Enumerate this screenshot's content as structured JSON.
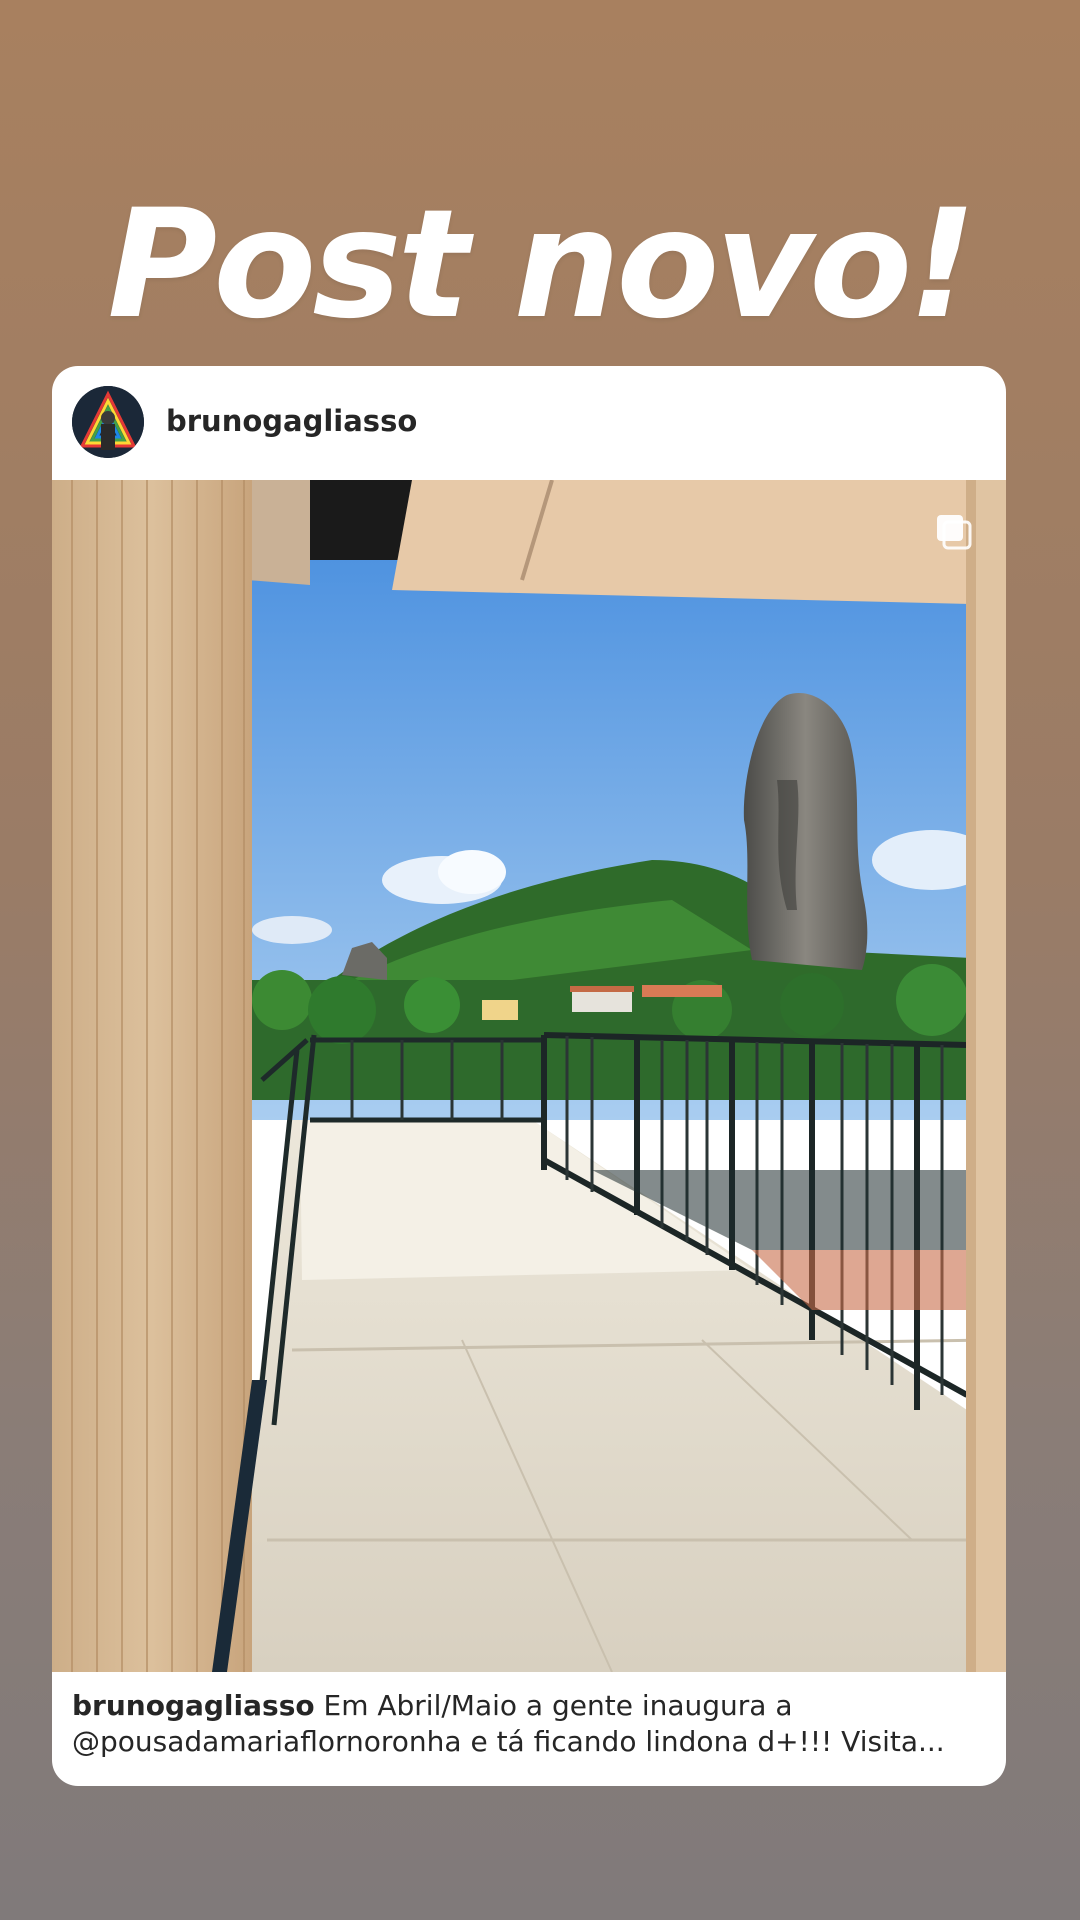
{
  "story": {
    "headline": "Post novo!"
  },
  "post": {
    "username": "brunogagliasso",
    "caption": {
      "username": "brunogagliasso",
      "line1": "Em Abril/Maio a gente inaugura a",
      "line2": "@pousadamariaflornoronha e tá ficando lindona d+!!! Visita..."
    },
    "icons": {
      "avatar": "profile-avatar",
      "carousel": "multiple-photos-icon"
    },
    "colors": {
      "card_bg": "#ffffff",
      "text": "#262626",
      "sky": "#5fa2e6"
    }
  }
}
